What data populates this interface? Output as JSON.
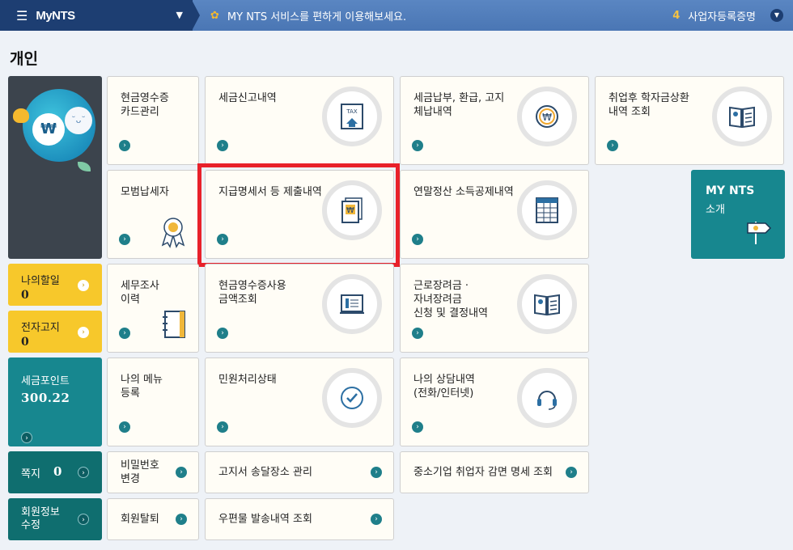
{
  "topbar": {
    "logo": "MyNTS",
    "notice": "MY NTS 서비스를 편하게 이용해보세요.",
    "notice_num": "4",
    "notice_right": "사업자등록증명"
  },
  "section_title": "개인",
  "left": {
    "todo_label": "나의할일",
    "todo_value": "0",
    "ebill_label": "전자고지",
    "ebill_value": "0",
    "point_label": "세금포인트",
    "point_value": "300.22",
    "note_label": "쪽지",
    "note_value": "0",
    "member_line1": "회원정보",
    "member_line2": "수정"
  },
  "cards": {
    "c1": [
      "현금영수증",
      "카드관리"
    ],
    "c2": [
      "세금신고내역"
    ],
    "c3": [
      "세금납부, 환급, 고지",
      "체납내역"
    ],
    "c4": [
      "취업후 학자금상환",
      "내역 조회"
    ],
    "c5": [
      "모범납세자"
    ],
    "c6": [
      "지급명세서 등 제출내역"
    ],
    "c7": [
      "연말정산 소득공제내역"
    ],
    "c8": [
      "세무조사",
      "이력"
    ],
    "c9": [
      "현금영수증사용",
      "금액조회"
    ],
    "c10": [
      "근로장려금 ·",
      "자녀장려금",
      "신청 및 결정내역"
    ],
    "c11": [
      "나의 메뉴",
      "등록"
    ],
    "c12": [
      "민원처리상태"
    ],
    "c13": [
      "나의 상담내역",
      "(전화/인터넷)"
    ],
    "s1": [
      "비밀번호",
      "변경"
    ],
    "s2": [
      "고지서 송달장소 관리"
    ],
    "s3": [
      "중소기업 취업자 감면 명세 조회"
    ],
    "s4": [
      "회원탈퇴"
    ],
    "s5": [
      "우편물 발송내역 조회"
    ]
  },
  "intro": {
    "title": "MY NTS",
    "sub": "소개"
  },
  "icons": {
    "tax_doc_text": "TAX"
  }
}
